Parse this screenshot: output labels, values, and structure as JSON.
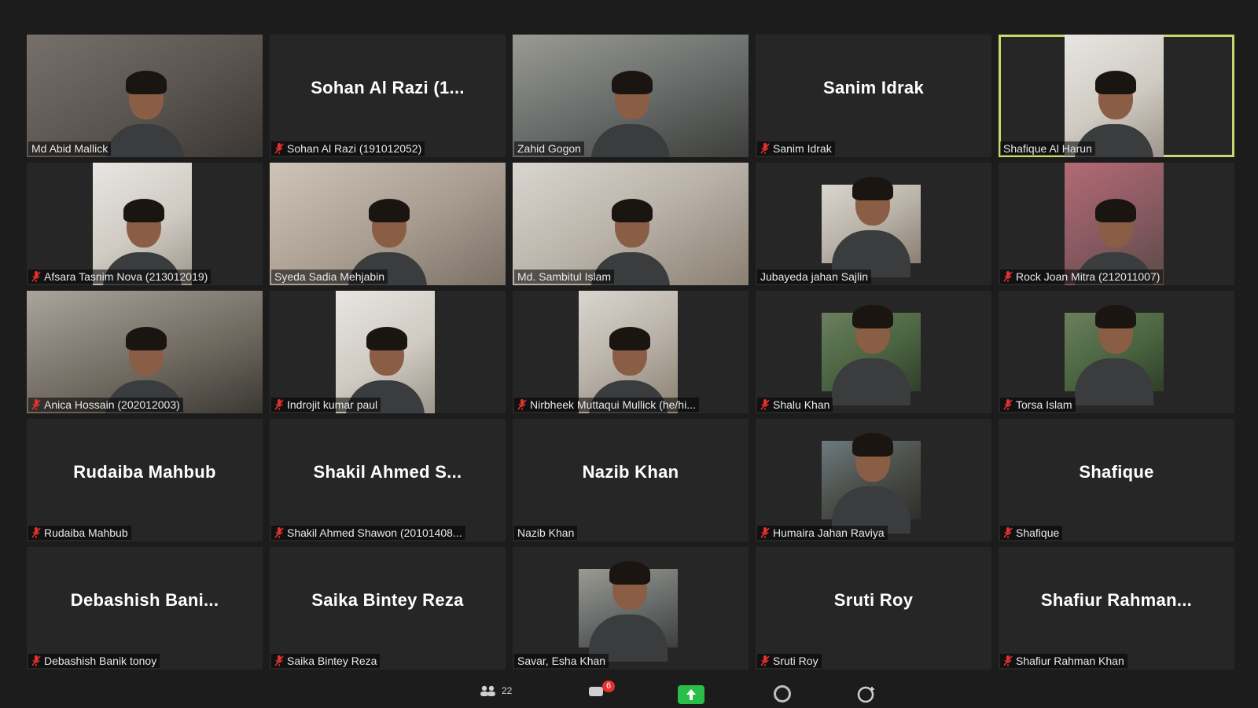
{
  "meeting": {
    "participant_count": "22",
    "chat_badge": "6",
    "active_speaker_color": "#c9d86a",
    "muted_icon_color": "#e5312d"
  },
  "tiles": [
    {
      "display": "video",
      "palette": "p9",
      "label": "Md Abid Mallick",
      "muted": false
    },
    {
      "display": "name",
      "big": "Sohan  Al  Razi  (1...",
      "label": "Sohan Al Razi (191012052)",
      "muted": true
    },
    {
      "display": "video",
      "palette": "p2",
      "label": "Zahid Gogon",
      "muted": false
    },
    {
      "display": "name",
      "big": "Sanim  Idrak",
      "label": "Sanim Idrak",
      "muted": true
    },
    {
      "display": "video",
      "palette": "p5",
      "label": "Shafique Al Harun",
      "muted": false,
      "active": true
    },
    {
      "display": "video",
      "palette": "p5",
      "label": "Afsara Tasnim Nova (213012019)",
      "muted": true
    },
    {
      "display": "video",
      "palette": "p8",
      "label": "Syeda Sadia Mehjabin",
      "muted": false
    },
    {
      "display": "video",
      "palette": "p3",
      "label": "Md. Sambitul Islam",
      "muted": false
    },
    {
      "display": "video",
      "palette": "p3",
      "label": "Jubayeda jahan Sajlin",
      "muted": false
    },
    {
      "display": "video",
      "palette": "p7",
      "label": "Rock Joan Mitra (212011007)",
      "muted": true
    },
    {
      "display": "video",
      "palette": "p4",
      "label": "Anica Hossain (202012003)",
      "muted": true
    },
    {
      "display": "video",
      "palette": "p5",
      "label": "Indrojit kumar paul",
      "muted": true
    },
    {
      "display": "video",
      "palette": "p3",
      "label": "Nirbheek Muttaqui Mullick (he/hi...",
      "muted": true
    },
    {
      "display": "video",
      "palette": "p6",
      "label": "Shalu Khan",
      "muted": true
    },
    {
      "display": "video",
      "palette": "p6",
      "label": "Torsa Islam",
      "muted": true
    },
    {
      "display": "name",
      "big": "Rudaiba  Mahbub",
      "label": "Rudaiba Mahbub",
      "muted": true
    },
    {
      "display": "name",
      "big": "Shakil  Ahmed  S...",
      "label": "Shakil Ahmed Shawon (20101408...",
      "muted": true
    },
    {
      "display": "name",
      "big": "Nazib  Khan",
      "label": "Nazib Khan",
      "muted": false
    },
    {
      "display": "video",
      "palette": "p1",
      "label": "Humaira Jahan Raviya",
      "muted": true
    },
    {
      "display": "name",
      "big": "Shafique",
      "label": "Shafique",
      "muted": true
    },
    {
      "display": "name",
      "big": "Debashish  Bani...",
      "label": "Debashish Banik tonoy",
      "muted": true
    },
    {
      "display": "name",
      "big": "Saika  Bintey  Reza",
      "label": "Saika Bintey Reza",
      "muted": true
    },
    {
      "display": "video",
      "palette": "p2",
      "label": "Savar, Esha Khan",
      "muted": false
    },
    {
      "display": "name",
      "big": "Sruti  Roy",
      "label": "Sruti Roy",
      "muted": true
    },
    {
      "display": "name",
      "big": "Shafiur  Rahman...",
      "label": "Shafiur Rahman Khan",
      "muted": true
    }
  ]
}
